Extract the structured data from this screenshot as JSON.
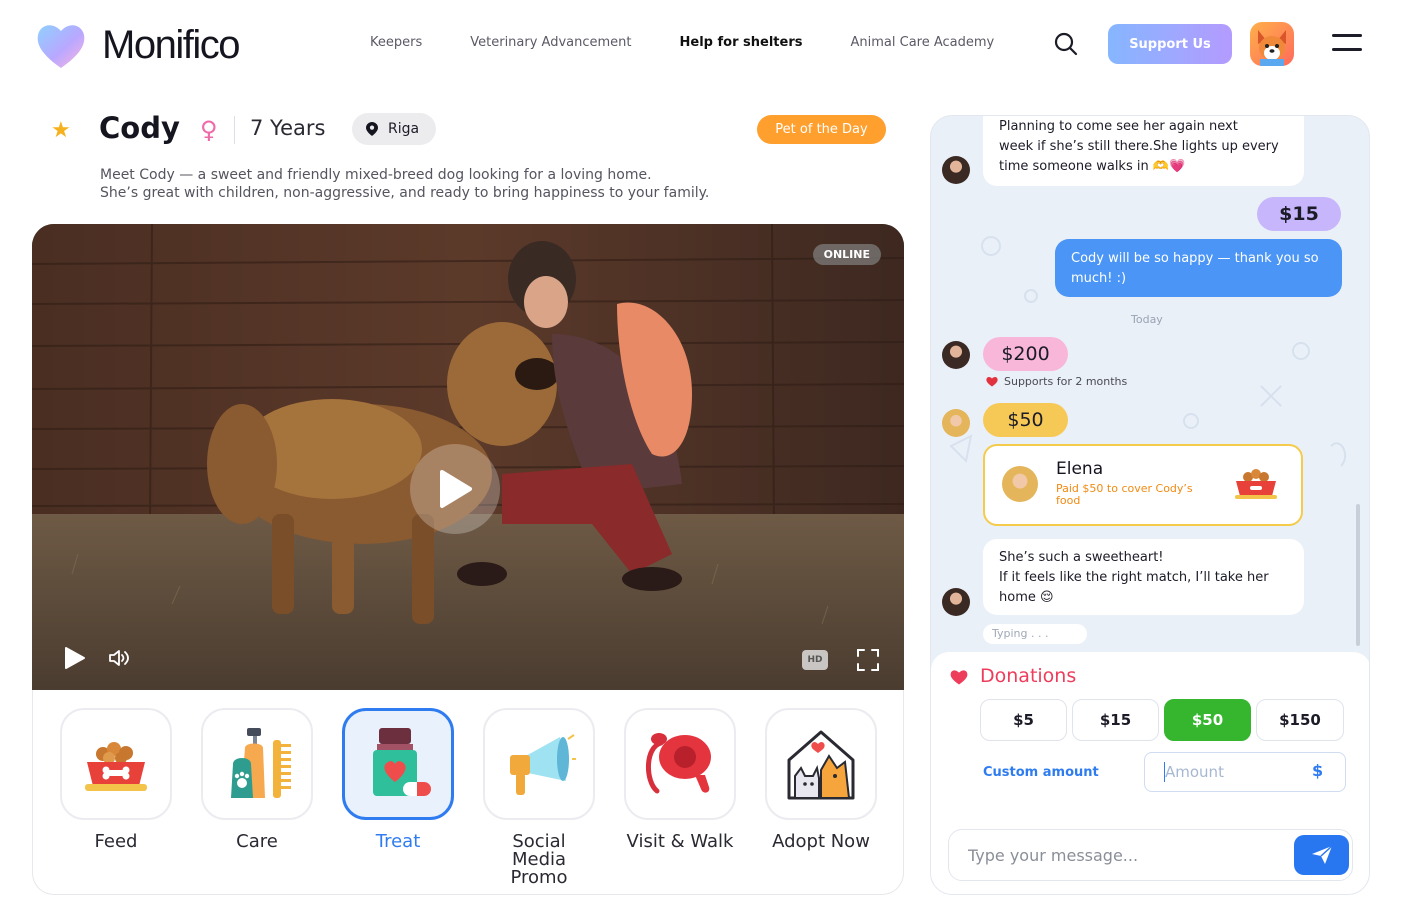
{
  "brand": {
    "name": "Monifico"
  },
  "nav": {
    "items": [
      {
        "label": "Keepers"
      },
      {
        "label": "Veterinary Advancement"
      },
      {
        "label": "Help for shelters"
      },
      {
        "label": "Animal Care Academy"
      }
    ],
    "active": "Help for shelters",
    "support_label": "Support Us"
  },
  "pet": {
    "name": "Cody",
    "gender_symbol": "♀",
    "age": "7 Years",
    "location": "Riga",
    "badge": "Pet of the Day",
    "description_line1": "Meet Cody — a sweet and friendly mixed-breed dog looking for a loving home.",
    "description_line2": "She’s great with children, non-aggressive, and ready to bring happiness to your family."
  },
  "video": {
    "status": "ONLINE",
    "quality": "HD"
  },
  "actions": [
    {
      "label": "Feed",
      "icon": "food-bowl-icon"
    },
    {
      "label": "Care",
      "icon": "shampoo-comb-icon"
    },
    {
      "label": "Treat",
      "icon": "medicine-icon"
    },
    {
      "label_line1": "Social Media",
      "label_line2": "Promo",
      "icon": "megaphone-icon"
    },
    {
      "label": "Visit & Walk",
      "icon": "leash-icon"
    },
    {
      "label": "Adopt Now",
      "icon": "pet-house-icon"
    }
  ],
  "selected_action": "Treat",
  "chat": {
    "messages": {
      "m1_l1": "Planning to come see her again next",
      "m1_l2": "week if she’s still there.She lights up every",
      "m1_l3": "time someone walks in 🫶💗",
      "donation_15": "$15",
      "reply_l1": "Cody will be so happy — thank you so",
      "reply_l2": "much! :)",
      "divider": "Today",
      "donation_200": "$200",
      "support_note": "Supports for 2 months",
      "donation_50": "$50",
      "card_name": "Elena",
      "card_text_l1": "Paid $50 to cover Cody’s",
      "card_text_l2": "food",
      "m2_l1": "She’s such a sweetheart!",
      "m2_l2": "If it feels like the right match, I’ll take her",
      "m2_l3": "home 😌",
      "typing": "Typing . . ."
    }
  },
  "donations": {
    "title": "Donations",
    "amounts": [
      "$5",
      "$15",
      "$50",
      "$150"
    ],
    "selected": "$50",
    "custom_label": "Custom amount",
    "amount_placeholder": "Amount",
    "currency": "$"
  },
  "composer": {
    "placeholder": "Type your message..."
  },
  "colors": {
    "accent_blue": "#2f7cf0",
    "badge_orange": "#ff9f2e",
    "donate_green": "#36b52f",
    "donation_red": "#ee3d5b"
  }
}
